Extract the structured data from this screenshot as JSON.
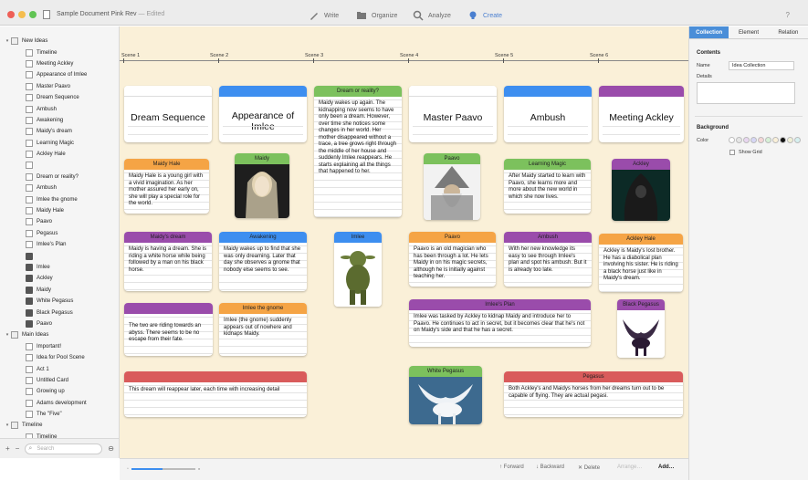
{
  "window": {
    "title": "Sample Document Pink Rev",
    "edited": "— Edited",
    "toolbar": {
      "write": "Write",
      "organize": "Organize",
      "analyze": "Analyze",
      "create": "Create",
      "help": "?"
    }
  },
  "sidebar": {
    "groups": [
      {
        "label": "New Ideas"
      },
      {
        "label": "Main Ideas"
      },
      {
        "label": "Timeline"
      }
    ],
    "new_ideas": [
      "Timeline",
      "Meeting Ackley",
      "Appearance of Imlee",
      "Master Paavo",
      "Dream Sequence",
      "Ambush",
      "Awakening",
      "Maidy's dream",
      "Learning Magic",
      "Ackley Hale",
      "",
      "Dream or reality?",
      "Ambush",
      "Imlee the gnome",
      "Maidy Hale",
      "Paavo",
      "Pegasus",
      "Imlee's Plan",
      "",
      "Imlee",
      "Ackley",
      "Maidy",
      "White Pegasus",
      "Black Pegasus",
      "Paavo"
    ],
    "main_ideas": [
      "Important!",
      "Idea for Pool Scene",
      "Act 1",
      "Untitled Card",
      "Growing up",
      "Adams development",
      "The \"Five\""
    ],
    "timeline": [
      "Timeline",
      "Timeline"
    ],
    "search_placeholder": "Search",
    "add": "+",
    "remove": "−"
  },
  "ruler": {
    "scenes": [
      "Scene 1",
      "Scene 2",
      "Scene 3",
      "Scene 4",
      "Scene 5",
      "Scene 6"
    ]
  },
  "cards": {
    "dream_sequence": {
      "title": "Dream Sequence"
    },
    "appearance": {
      "title": "Appearance of Imlee"
    },
    "dream_reality": {
      "header": "Dream or reality?",
      "text": "Maidy wakes up again. The kidnapping now seems to have only been a dream. However, over time she notices some changes in her world. Her mother disappeared without a trace, a tree grows right through the middle of her house and suddenly Imlee reappears. He starts explaining all the things that happened to her."
    },
    "master_paavo": {
      "title": "Master Paavo"
    },
    "ambush": {
      "title": "Ambush"
    },
    "meeting_ackley": {
      "title": "Meeting Ackley"
    },
    "maidy_hale": {
      "header": "Maidy Hale",
      "text": "Maidy Hale is a young girl with a vivid imagination. As her mother assured her early on, she will play a special role for the world."
    },
    "maidy": {
      "header": "Maidy"
    },
    "paavo_img": {
      "header": "Paavo"
    },
    "learning_magic": {
      "header": "Learning Magic",
      "text": "After Maidy started to learn with Paavo, she learns more and more about the new world in which she now lives."
    },
    "ackley_img": {
      "header": "Ackley"
    },
    "maidys_dream": {
      "header": "Maidy's dream",
      "text": "Maidy is having a dream. She is riding a white horse while being followed by a man on his black horse."
    },
    "awakening": {
      "header": "Awakening",
      "text": "Maidy wakes up to find that she was only dreaming. Later that day she observes a gnome that nobody else seems to see."
    },
    "imlee_img": {
      "header": "Imlee"
    },
    "paavo": {
      "header": "Paavo",
      "text": "Paavo is an old magician who has been through a lot. He lets Maidy in on his magic secrets, although he is initially against teaching her."
    },
    "ambush_card": {
      "header": "Ambush",
      "text": "With her new knowledge its easy to see through Imlee's plan and spot his ambush. But it is already too late."
    },
    "ackley_hale": {
      "header": "Ackley Hale",
      "text": "Ackley is Maidy's lost brother. He has a diabolical plan involving his sister. He is riding a black horse just like in Maidy's dream."
    },
    "purple_blank": {
      "header": "",
      "text": "The two are riding towards an abyss. There seems to be no escape from their fate."
    },
    "imlee_gnome": {
      "header": "Imlee the gnome",
      "text": "Imlee (the gnome) suddenly appears out of nowhere and kidnaps Maidy."
    },
    "imlees_plan": {
      "header": "Imlee's Plan",
      "text": "Imlee was tasked by Ackley to kidnap Maidy and introduce her to Paavo. He continues to act in secret, but it becomes clear that he's not on Maidy's side and that he has a secret."
    },
    "black_pegasus": {
      "header": "Black Pegasus"
    },
    "red_blank": {
      "header": "",
      "text": "This dream will reappear later, each time with increasing detail"
    },
    "white_pegasus": {
      "header": "White Pegasus"
    },
    "pegasus": {
      "header": "Pegasus",
      "text": "Both Ackley's and Maidys horses from her dreams turn out to be capable of flying. They are actual pegasi."
    }
  },
  "canvas_footer": {
    "forward": "↑ Forward",
    "backward": "↓ Backward",
    "delete": "✕ Delete",
    "arrange": "Arrange…",
    "add": "Add…"
  },
  "inspector": {
    "tabs": [
      "Collection",
      "Element",
      "Relation"
    ],
    "contents": "Contents",
    "name_label": "Name",
    "name_value": "Idea Collection",
    "details_label": "Details",
    "background": "Background",
    "color_label": "Color",
    "show_grid": "Show Grid",
    "swatch_colors": [
      "#ffffff",
      "#e6e6e6",
      "#e8d6f0",
      "#d6d6f5",
      "#f5d6d6",
      "#d6f0d6",
      "#faf0d8",
      "#111111",
      "#f0f0d6",
      "#d6f0f0"
    ]
  }
}
